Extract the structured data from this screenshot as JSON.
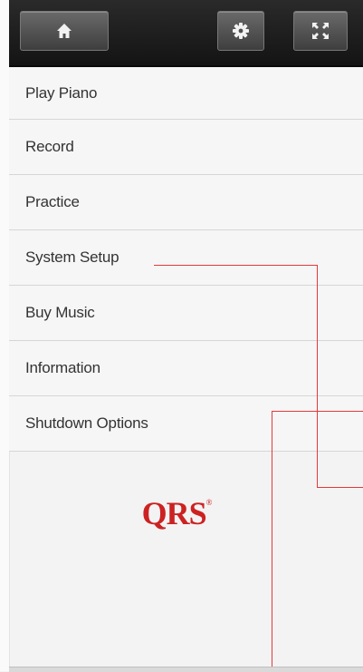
{
  "toolbar": {
    "home_icon": "home-icon",
    "settings_icon": "gear-icon",
    "fullscreen_icon": "fullscreen-icon"
  },
  "menu": {
    "items": [
      {
        "label": "Play Piano"
      },
      {
        "label": "Record"
      },
      {
        "label": "Practice"
      },
      {
        "label": "System Setup"
      },
      {
        "label": "Buy Music"
      },
      {
        "label": "Information"
      },
      {
        "label": "Shutdown Options"
      }
    ]
  },
  "logo": {
    "text": "QRS",
    "mark": "®"
  },
  "colors": {
    "toolbar": "#1c1c1c",
    "logo": "#cc2222",
    "annotation_line": "#e23a3a"
  }
}
